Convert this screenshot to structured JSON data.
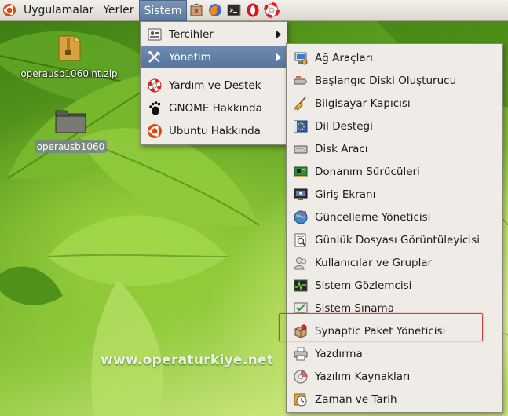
{
  "panel": {
    "menus": [
      {
        "label": "Uygulamalar"
      },
      {
        "label": "Yerler"
      },
      {
        "label": "Sistem"
      }
    ]
  },
  "desktop": {
    "icons": [
      {
        "label": "operausb1060int.zip",
        "icon": "archive-icon"
      },
      {
        "label": "operausb1060",
        "icon": "folder-icon"
      }
    ],
    "watermark": "www.operaturkiye.net"
  },
  "sistem_menu": {
    "items": [
      {
        "label": "Tercihler",
        "icon": "preferences-icon",
        "submenu": true
      },
      {
        "label": "Yönetim",
        "icon": "tools-icon",
        "submenu": true,
        "highlighted": true
      },
      {
        "label": "Yardım ve Destek",
        "icon": "help-lifebuoy-icon"
      },
      {
        "label": "GNOME Hakkında",
        "icon": "gnome-foot-icon"
      },
      {
        "label": "Ubuntu Hakkında",
        "icon": "ubuntu-logo-icon"
      }
    ]
  },
  "yonetim_menu": {
    "items": [
      {
        "label": "Ağ Araçları",
        "icon": "network-tools-icon"
      },
      {
        "label": "Başlangıç Diski Oluşturucu",
        "icon": "usb-disk-icon"
      },
      {
        "label": "Bilgisayar Kapıcısı",
        "icon": "broom-icon"
      },
      {
        "label": "Dil Desteği",
        "icon": "language-flag-icon"
      },
      {
        "label": "Disk Aracı",
        "icon": "disk-icon"
      },
      {
        "label": "Donanım Sürücüleri",
        "icon": "hardware-card-icon"
      },
      {
        "label": "Giriş Ekranı",
        "icon": "login-screen-icon"
      },
      {
        "label": "Güncelleme Yöneticisi",
        "icon": "update-globe-icon"
      },
      {
        "label": "Günlük Dosyası Görüntüleyicisi",
        "icon": "log-viewer-icon"
      },
      {
        "label": "Kullanıcılar ve Gruplar",
        "icon": "users-icon"
      },
      {
        "label": "Sistem Gözlemcisi",
        "icon": "system-monitor-icon"
      },
      {
        "label": "Sistem Sınama",
        "icon": "system-test-icon"
      },
      {
        "label": "Synaptic Paket Yöneticisi",
        "icon": "synaptic-package-icon"
      },
      {
        "label": "Yazdırma",
        "icon": "printer-icon"
      },
      {
        "label": "Yazılım Kaynakları",
        "icon": "software-sources-icon"
      },
      {
        "label": "Zaman ve Tarih",
        "icon": "clock-icon"
      }
    ]
  },
  "colors": {
    "menu_highlight": "#56749c",
    "annotation_box": "#d9403a"
  }
}
